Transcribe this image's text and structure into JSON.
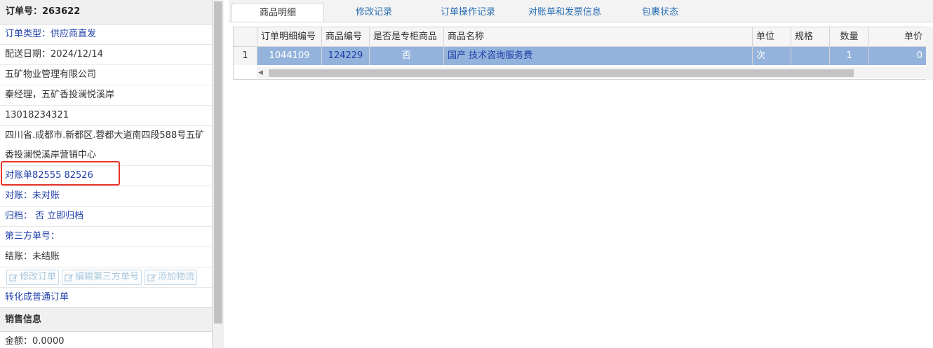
{
  "order": {
    "header": "订单号：263622",
    "type": "订单类型：供应商直发",
    "delivery_date": "配送日期：2024/12/14",
    "company": "五矿物业管理有限公司",
    "contact": "秦经理，五矿香投澜悦溪岸",
    "phone": "13018234321",
    "address_line1": "四川省.成都市.新都区.蓉都大道南四段588号五矿",
    "address_line2": "香投澜悦溪岸营销中心",
    "statement_numbers": "对账单82555 82526",
    "reconcile": "对账：未对账",
    "archive": "归档：  否 立即归档",
    "third_party": "第三方单号：",
    "settlement": "结账：未结账",
    "convert": "转化成普通订单"
  },
  "buttons": {
    "edit_order": "修改订单",
    "edit_third_party": "编辑第三方单号",
    "add_logistics": "添加物流"
  },
  "sales": {
    "header": "销售信息",
    "amount": "金额：0.0000"
  },
  "tabs": [
    "商品明细",
    "修改记录",
    "订单操作记录",
    "对账单和发票信息",
    "包裹状态"
  ],
  "grid": {
    "columns": [
      "订单明细编号",
      "商品编号",
      "是否是专柜商品",
      "商品名称",
      "单位",
      "规格",
      "数量",
      "单价"
    ],
    "rows": [
      {
        "index": "1",
        "detail_id": "1044109",
        "product_id": "124229",
        "counter": "否",
        "name": "国产 技术咨询服务费",
        "unit": "次",
        "spec": "",
        "qty": "1",
        "price": "0"
      }
    ]
  },
  "colors": {
    "highlight_box": "#e8342b",
    "selected_row": "#93b3dc",
    "link": "#1f3ea8"
  }
}
